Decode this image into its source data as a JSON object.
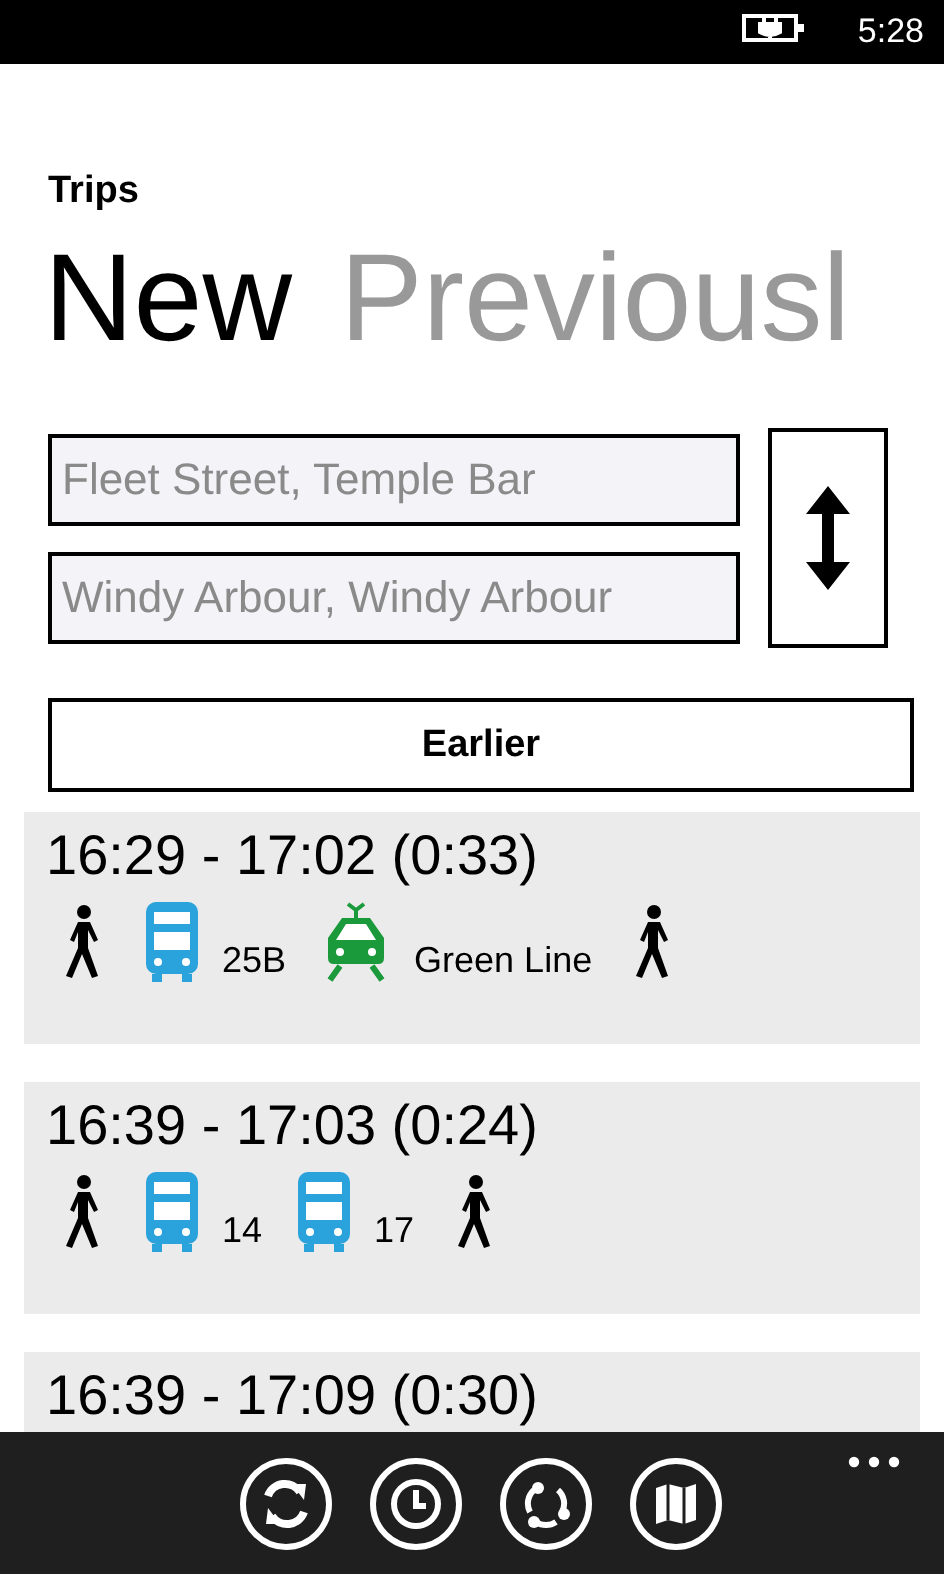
{
  "status_bar": {
    "time": "5:28"
  },
  "app_title": "Trips",
  "pivot": [
    {
      "label": "New",
      "selected": true
    },
    {
      "label": "Previousl",
      "selected": false
    }
  ],
  "from_field": {
    "value": "Fleet Street, Temple Bar"
  },
  "to_field": {
    "value": "Windy Arbour, Windy Arbour"
  },
  "earlier_button": "Earlier",
  "trips": [
    {
      "time": "16:29 - 17:02 (0:33)",
      "legs": [
        {
          "kind": "walk"
        },
        {
          "kind": "bus",
          "label": "25B"
        },
        {
          "kind": "tram",
          "label": "Green Line"
        },
        {
          "kind": "walk"
        }
      ]
    },
    {
      "time": "16:39 - 17:03 (0:24)",
      "legs": [
        {
          "kind": "walk"
        },
        {
          "kind": "bus",
          "label": "14"
        },
        {
          "kind": "bus",
          "label": "17"
        },
        {
          "kind": "walk"
        }
      ]
    },
    {
      "time": "16:39 - 17:09 (0:30)"
    }
  ],
  "app_bar": [
    {
      "kind": "refresh"
    },
    {
      "kind": "clock"
    },
    {
      "kind": "cycle"
    },
    {
      "kind": "map"
    }
  ]
}
